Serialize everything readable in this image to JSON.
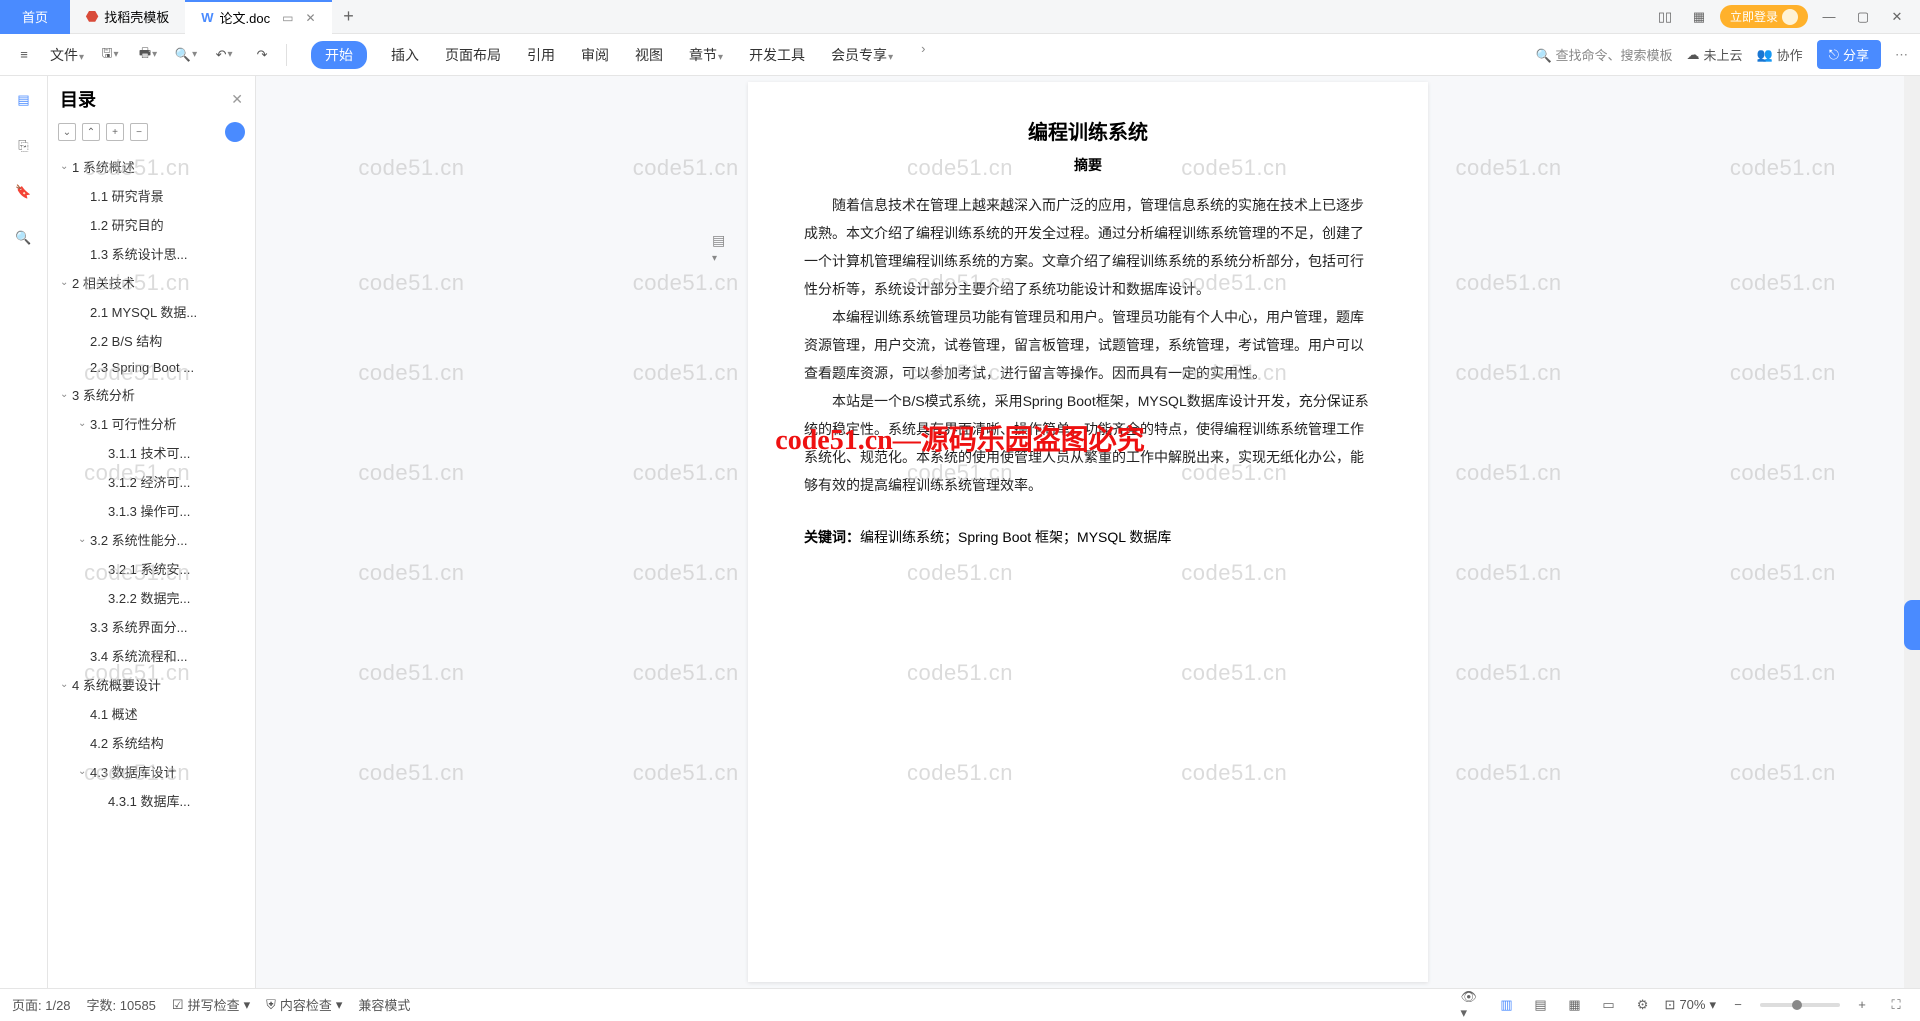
{
  "tabs": {
    "home": "首页",
    "template": "找稻壳模板",
    "doc": "论文.doc"
  },
  "titlebar": {
    "login": "立即登录"
  },
  "ribbon": {
    "menu": "文件",
    "tabs": [
      "开始",
      "插入",
      "页面布局",
      "引用",
      "审阅",
      "视图",
      "章节",
      "开发工具",
      "会员专享"
    ],
    "search": "查找命令、搜索模板",
    "cloud": "未上云",
    "collab": "协作",
    "share": "分享"
  },
  "outline": {
    "title": "目录",
    "items": [
      {
        "t": "1 系统概述",
        "l": 0,
        "e": 1
      },
      {
        "t": "1.1 研究背景",
        "l": 1
      },
      {
        "t": "1.2 研究目的",
        "l": 1
      },
      {
        "t": "1.3 系统设计思...",
        "l": 1
      },
      {
        "t": "2 相关技术",
        "l": 0,
        "e": 1
      },
      {
        "t": "2.1 MYSQL 数据...",
        "l": 1
      },
      {
        "t": "2.2 B/S 结构",
        "l": 1
      },
      {
        "t": "2.3 Spring Boot ...",
        "l": 1
      },
      {
        "t": "3 系统分析",
        "l": 0,
        "e": 1
      },
      {
        "t": "3.1 可行性分析",
        "l": 1,
        "e": 1
      },
      {
        "t": "3.1.1 技术可...",
        "l": 2
      },
      {
        "t": "3.1.2 经济可...",
        "l": 2
      },
      {
        "t": "3.1.3 操作可...",
        "l": 2
      },
      {
        "t": "3.2 系统性能分...",
        "l": 1,
        "e": 1
      },
      {
        "t": "3.2.1 系统安...",
        "l": 2
      },
      {
        "t": "3.2.2 数据完...",
        "l": 2
      },
      {
        "t": "3.3 系统界面分...",
        "l": 1
      },
      {
        "t": "3.4 系统流程和...",
        "l": 1
      },
      {
        "t": "4 系统概要设计",
        "l": 0,
        "e": 1
      },
      {
        "t": "4.1 概述",
        "l": 1
      },
      {
        "t": "4.2 系统结构",
        "l": 1
      },
      {
        "t": "4.3 数据库设计",
        "l": 1,
        "e": 1
      },
      {
        "t": "4.3.1 数据库...",
        "l": 2
      }
    ]
  },
  "doc": {
    "title": "编程训练系统",
    "sub": "摘要",
    "p1": "随着信息技术在管理上越来越深入而广泛的应用，管理信息系统的实施在技术上已逐步成熟。本文介绍了编程训练系统的开发全过程。通过分析编程训练系统管理的不足，创建了一个计算机管理编程训练系统的方案。文章介绍了编程训练系统的系统分析部分，包括可行性分析等，系统设计部分主要介绍了系统功能设计和数据库设计。",
    "p2": "本编程训练系统管理员功能有管理员和用户。管理员功能有个人中心，用户管理，题库资源管理，用户交流，试卷管理，留言板管理，试题管理，系统管理，考试管理。用户可以查看题库资源，可以参加考试，进行留言等操作。因而具有一定的实用性。",
    "p3": "本站是一个B/S模式系统，采用Spring Boot框架，MYSQL数据库设计开发，充分保证系统的稳定性。系统具有界面清晰、操作简单，功能齐全的特点，使得编程训练系统管理工作系统化、规范化。本系统的使用使管理人员从繁重的工作中解脱出来，实现无纸化办公，能够有效的提高编程训练系统管理效率。",
    "kw_label": "关键词：",
    "kw": "编程训练系统；Spring Boot 框架；MYSQL 数据库"
  },
  "watermark": {
    "text": "code51.cn",
    "center": "code51.cn—源码乐园盗图必究"
  },
  "status": {
    "page": "页面: 1/28",
    "words": "字数: 10585",
    "spell": "拼写检查",
    "content": "内容检查",
    "compat": "兼容模式",
    "zoom": "70%"
  }
}
